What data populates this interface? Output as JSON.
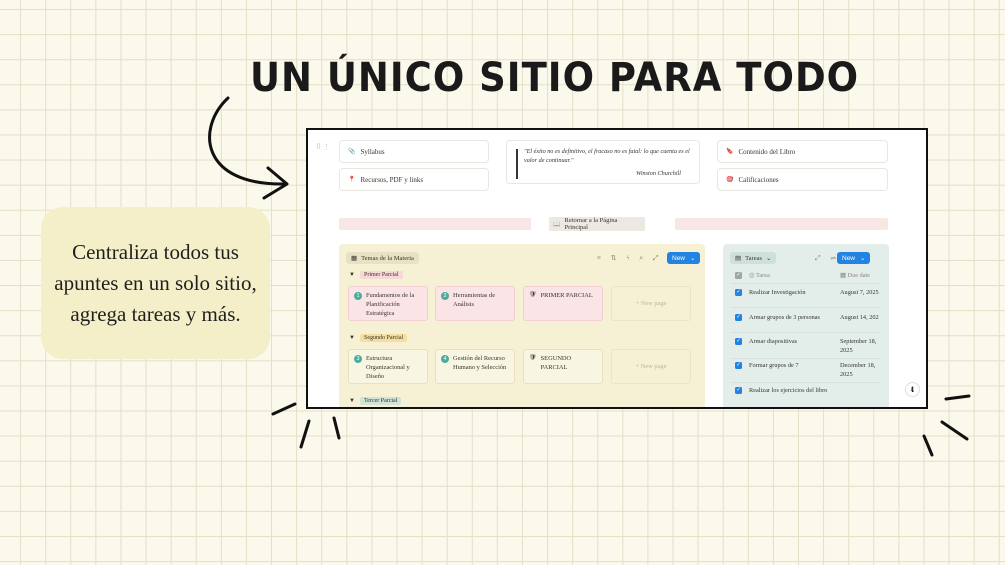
{
  "headline": "UN ÚNICO SITIO PARA TODO",
  "callout": "Centraliza todos tus apuntes en un solo sitio, agrega tareas y más.",
  "app": {
    "gutter_icon": "⠿ ⋮",
    "links_left": [
      {
        "icon": "paperclip-icon",
        "glyph": "📎",
        "label": "Syllabus"
      },
      {
        "icon": "pin-icon",
        "glyph": "📍",
        "label": "Recursos, PDF y links"
      }
    ],
    "quote": {
      "text": "\"El éxito no es definitivo, el fracaso no es fatal: lo que cuenta es el valor de continuar.\"",
      "author": "Winston Churchill"
    },
    "links_right": [
      {
        "icon": "bookmark-icon",
        "glyph": "🔖",
        "label": "Contenido del Libro"
      },
      {
        "icon": "target-icon",
        "glyph": "🎯",
        "label": "Calificaciones"
      }
    ],
    "return_button": {
      "glyph": "📖",
      "label": "Retornar a la Página Principal"
    },
    "board": {
      "view_label": "Temas de la Materia",
      "view_glyph": "▦",
      "toolbar_icons": "≡ ⇅ ϟ ⌕ ⤢ ⇌",
      "new_label": "New",
      "new_caret": "⌄",
      "groups": [
        {
          "name": "Primer Parcial",
          "cards": [
            {
              "num": "1",
              "title": "Fundamentos de la Planificación Estratégica"
            },
            {
              "num": "2",
              "title": "Herramientas de Análisis"
            },
            {
              "num": "",
              "title": "PRIMER PARCIAL",
              "glyph": "🛡"
            }
          ],
          "new_page": "+ New page"
        },
        {
          "name": "Segundo Parcial",
          "cards": [
            {
              "num": "3",
              "title": "Estructura Organizacional y Diseño"
            },
            {
              "num": "4",
              "title": "Gestión del Recurso Humano y Selección"
            },
            {
              "num": "",
              "title": "SEGUNDO PARCIAL",
              "glyph": "🛡"
            }
          ],
          "new_page": "+ New page"
        },
        {
          "name": "Tercer Parcial",
          "cards": []
        }
      ]
    },
    "tasks": {
      "view_label": "Tareas",
      "view_glyph": "▤",
      "view_caret": "⌄",
      "toolbar_icons": "⤢ ⇌",
      "new_label": "New",
      "new_caret": "⌄",
      "columns": [
        "Tarea",
        "Due date"
      ],
      "rows": [
        {
          "name": "Realizar Investigación",
          "date": "August 7, 2025"
        },
        {
          "name": "Armar grupos de 3 personas",
          "date": "August 14, 202"
        },
        {
          "name": "Armar diapositivas",
          "date": "September 18, 2025"
        },
        {
          "name": "Formar grupos de 7",
          "date": "December 18, 2025"
        },
        {
          "name": "Realizar los ejercicios del libro",
          "date": ""
        }
      ]
    },
    "badge": "ᵵ"
  },
  "colors": {
    "background": "#fbf8ec",
    "grid": "#e4dfc6",
    "callout": "#f4efc8",
    "board": "#f6f1d5",
    "tasks": "#e3eeea",
    "accent": "#2383e2",
    "card_pink": "#fbe4e6"
  }
}
